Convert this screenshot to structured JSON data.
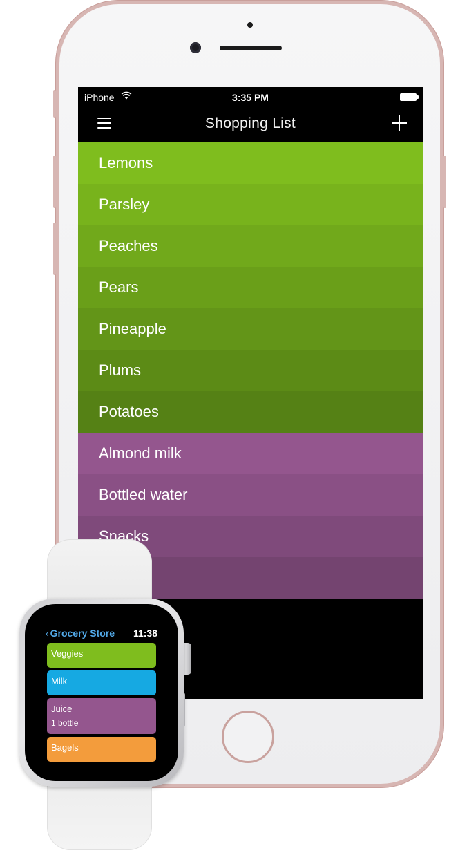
{
  "phone": {
    "status_bar": {
      "carrier": "iPhone",
      "time": "3:35 PM",
      "wifi_icon": "wifi-icon",
      "battery_icon": "battery-full-icon"
    },
    "nav": {
      "title": "Shopping List",
      "menu_icon": "hamburger-menu-icon",
      "add_icon": "plus-icon"
    },
    "items": [
      {
        "label": "Lemons",
        "color": "#7fbd1e"
      },
      {
        "label": "Parsley",
        "color": "#78b31c"
      },
      {
        "label": "Peaches",
        "color": "#71a91b"
      },
      {
        "label": "Pears",
        "color": "#6a9f19"
      },
      {
        "label": "Pineapple",
        "color": "#639518"
      },
      {
        "label": "Plums",
        "color": "#5c8b16"
      },
      {
        "label": "Potatoes",
        "color": "#558115"
      },
      {
        "label": "Almond milk",
        "color": "#94568e"
      },
      {
        "label": "Bottled water",
        "color": "#8a5085"
      },
      {
        "label": "Snacks",
        "color": "#7f4a7b"
      },
      {
        "label": "",
        "color": "#744470"
      }
    ]
  },
  "watch": {
    "back_label": "Grocery Store",
    "time": "11:38",
    "items": [
      {
        "label": "Veggies",
        "sublabel": "",
        "color": "#7fbd1e"
      },
      {
        "label": "Milk",
        "sublabel": "",
        "color": "#16a9e2"
      },
      {
        "label": "Juice",
        "sublabel": "1 bottle",
        "color": "#94568e"
      },
      {
        "label": "Bagels",
        "sublabel": "",
        "color": "#f39c3c"
      }
    ]
  }
}
